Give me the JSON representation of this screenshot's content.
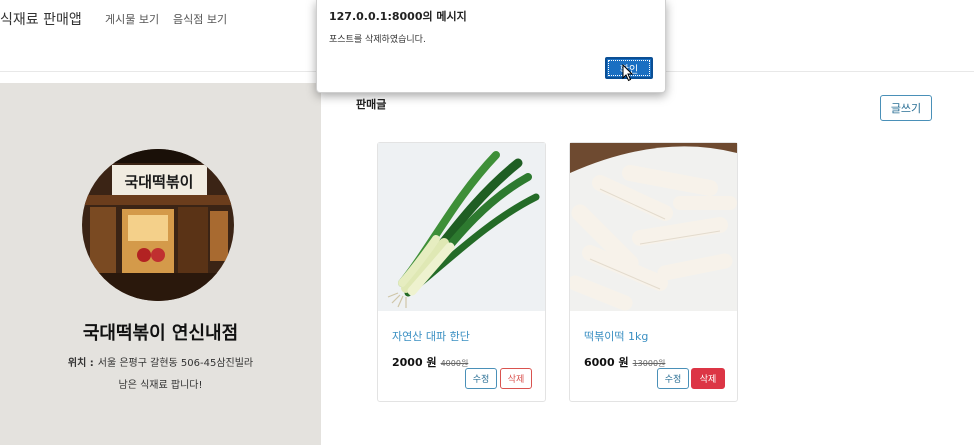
{
  "navbar": {
    "brand": "식재료 판매앱",
    "links": [
      "게시물 보기",
      "음식점 보기"
    ]
  },
  "sidebar": {
    "shop_name": "국대떡볶이 연신내점",
    "location_label": "위치 :",
    "location_value": "서울 은평구 갈현동 506-45삼진빌라",
    "description": "남은 식재료 팝니다!",
    "sign_text": "국대떡볶이"
  },
  "main": {
    "section_title": "판매글",
    "write_button": "글쓰기",
    "products": [
      {
        "title": "자연산 대파 한단",
        "price": "2000 원",
        "old_price": "4000원",
        "edit_label": "수정",
        "delete_label": "삭제",
        "image": "green-onion"
      },
      {
        "title": "떡볶이떡 1kg",
        "price": "6000 원",
        "old_price": "13000원",
        "edit_label": "수정",
        "delete_label": "삭제",
        "image": "rice-cake"
      }
    ]
  },
  "dialog": {
    "title": "127.0.0.1:8000의 메시지",
    "message": "포스트를 삭제하였습니다.",
    "ok_label": "확인"
  },
  "colors": {
    "sidebar_bg": "#e4e2de",
    "link_blue": "#3a8fc2",
    "danger": "#dc3545",
    "ok_button": "#1a6fc2"
  }
}
